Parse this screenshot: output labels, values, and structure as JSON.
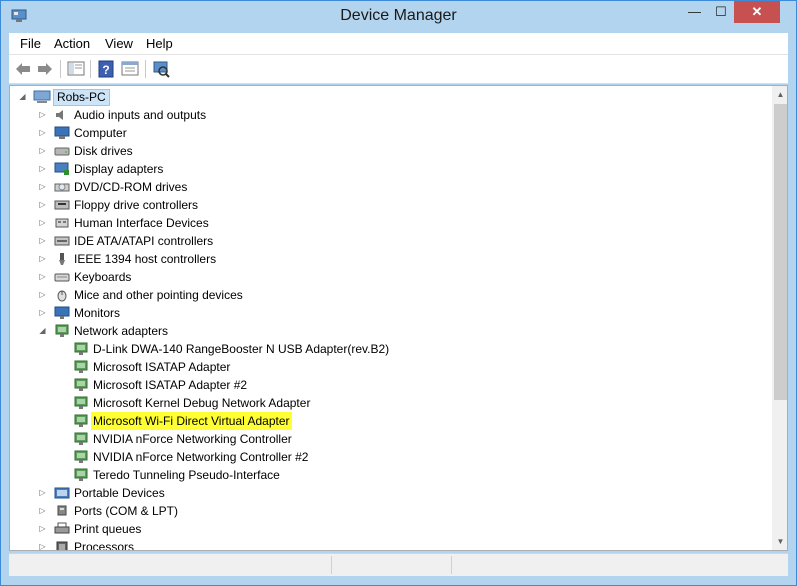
{
  "window": {
    "title": "Device Manager",
    "controls": {
      "minimize": "—",
      "maximize": "☐",
      "close": "✕"
    }
  },
  "menu": [
    "File",
    "Action",
    "View",
    "Help"
  ],
  "toolbar": [
    "back",
    "forward",
    "show-hide-console-tree",
    "help",
    "properties",
    "scan-hardware-changes"
  ],
  "tree": {
    "root": "Robs-PC",
    "categories_before": [
      {
        "label": "Audio inputs and outputs",
        "icon": "speaker-icon"
      },
      {
        "label": "Computer",
        "icon": "computer-icon"
      },
      {
        "label": "Disk drives",
        "icon": "disk-drive-icon"
      },
      {
        "label": "Display adapters",
        "icon": "display-adapter-icon"
      },
      {
        "label": "DVD/CD-ROM drives",
        "icon": "dvd-drive-icon"
      },
      {
        "label": "Floppy drive controllers",
        "icon": "floppy-controller-icon"
      },
      {
        "label": "Human Interface Devices",
        "icon": "hid-icon"
      },
      {
        "label": "IDE ATA/ATAPI controllers",
        "icon": "ide-controller-icon"
      },
      {
        "label": "IEEE 1394 host controllers",
        "icon": "ieee1394-icon"
      },
      {
        "label": "Keyboards",
        "icon": "keyboard-icon"
      },
      {
        "label": "Mice and other pointing devices",
        "icon": "mouse-icon"
      },
      {
        "label": "Monitors",
        "icon": "monitor-icon"
      }
    ],
    "network": {
      "label": "Network adapters",
      "expanded": true,
      "children": [
        "D-Link DWA-140 RangeBooster N USB Adapter(rev.B2)",
        "Microsoft ISATAP Adapter",
        "Microsoft ISATAP Adapter #2",
        "Microsoft Kernel Debug Network Adapter",
        "Microsoft Wi-Fi Direct Virtual Adapter",
        "NVIDIA nForce Networking Controller",
        "NVIDIA nForce Networking Controller #2",
        "Teredo Tunneling Pseudo-Interface"
      ],
      "highlighted": "Microsoft Wi-Fi Direct Virtual Adapter",
      "highlight_color": "#ffff33"
    },
    "categories_after": [
      {
        "label": "Portable Devices",
        "icon": "portable-device-icon"
      },
      {
        "label": "Ports (COM & LPT)",
        "icon": "port-icon"
      },
      {
        "label": "Print queues",
        "icon": "printer-icon"
      },
      {
        "label": "Processors",
        "icon": "processor-icon"
      }
    ]
  },
  "colors": {
    "frame": "#b3d4ef",
    "close_button": "#c75050",
    "selection": "#cce4f7"
  }
}
